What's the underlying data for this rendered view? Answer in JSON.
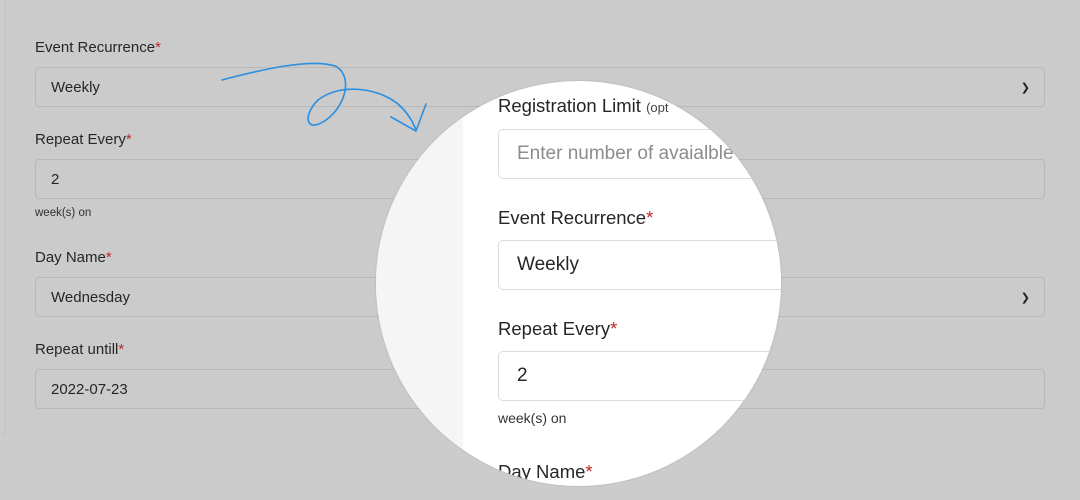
{
  "form": {
    "recurrence": {
      "label": "Event Recurrence",
      "required_mark": "*",
      "value": "Weekly"
    },
    "repeat_every": {
      "label": "Repeat Every",
      "required_mark": "*",
      "value": "2",
      "suffix": "week(s) on"
    },
    "day_name": {
      "label": "Day Name",
      "required_mark": "*",
      "value": "Wednesday"
    },
    "repeat_until": {
      "label": "Repeat untill",
      "required_mark": "*",
      "value": "2022-07-23"
    }
  },
  "magnifier": {
    "registration": {
      "label": "Registration Limit",
      "label_note": "(opt",
      "placeholder": "Enter number of avaialble"
    },
    "recurrence": {
      "label": "Event Recurrence",
      "required_mark": "*",
      "value": "Weekly"
    },
    "repeat_every": {
      "label": "Repeat Every",
      "required_mark": "*",
      "value": "2",
      "suffix": "week(s) on"
    },
    "day_name": {
      "label": "Day Name",
      "required_mark": "*"
    }
  },
  "colors": {
    "required": "#c0282d",
    "arrow": "#2b8fe0"
  },
  "icons": {
    "select_arrow": "chevron-down-icon",
    "annotation": "hand-drawn-arrow-icon"
  }
}
